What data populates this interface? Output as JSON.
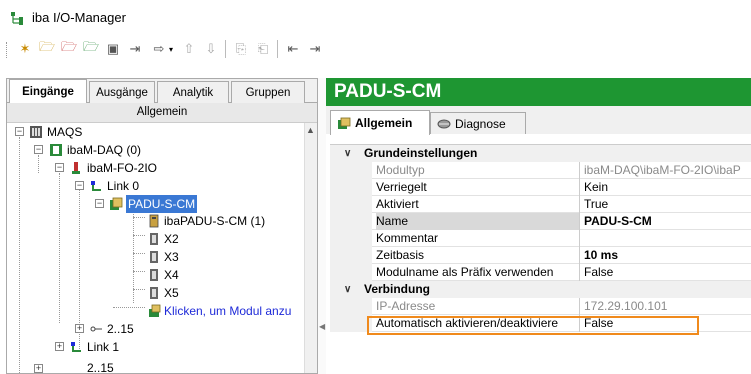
{
  "app": {
    "title": "iba I/O-Manager",
    "icon": "tree-network-icon"
  },
  "toolbar": {
    "buttons": [
      {
        "name": "new-icon",
        "glyph": "✶"
      },
      {
        "name": "open-icon",
        "glyph": "🗁"
      },
      {
        "name": "export-icon",
        "glyph": "🗁"
      },
      {
        "name": "import-icon",
        "glyph": "🗁"
      },
      {
        "name": "save-icon",
        "glyph": "▣"
      },
      {
        "name": "apply-icon",
        "glyph": "⇥"
      },
      {
        "name": "transfer-icon",
        "glyph": "⇨"
      },
      {
        "name": "move-up-icon",
        "glyph": "⇧"
      },
      {
        "name": "move-down-icon",
        "glyph": "⇩"
      },
      {
        "name": "copy-icon",
        "glyph": "⎘"
      },
      {
        "name": "paste-icon",
        "glyph": "⎗"
      },
      {
        "name": "collapse-icon",
        "glyph": "⇤"
      },
      {
        "name": "expand-icon",
        "glyph": "⇥"
      }
    ]
  },
  "left_tabs": [
    "Eingänge",
    "Ausgänge",
    "Analytik",
    "Gruppen"
  ],
  "left_subheader": "Allgemein",
  "tree": {
    "maqs": "MAQS",
    "ibam_daq": "ibaM-DAQ (0)",
    "ibam_fo": "ibaM-FO-2IO",
    "link0": "Link 0",
    "padu": "PADU-S-CM",
    "ibapadu": "ibaPADU-S-CM (1)",
    "x2": "X2",
    "x3": "X3",
    "x4": "X4",
    "x5": "X5",
    "add_module": "Klicken, um Modul anzu",
    "range": "2..15",
    "link1": "Link 1",
    "bottom": "2..15"
  },
  "right": {
    "header": "PADU-S-CM",
    "tabs": [
      "Allgemein",
      "Diagnose"
    ],
    "categories": {
      "grund": "Grundeinstellungen",
      "verbindung": "Verbindung"
    },
    "properties": [
      {
        "name": "Modultyp",
        "value": "ibaM-DAQ\\ibaM-FO-2IO\\ibaP"
      },
      {
        "name": "Verriegelt",
        "value": "Kein"
      },
      {
        "name": "Aktiviert",
        "value": "True"
      },
      {
        "name": "Name",
        "value": "PADU-S-CM"
      },
      {
        "name": "Kommentar",
        "value": ""
      },
      {
        "name": "Zeitbasis",
        "value": "10 ms"
      },
      {
        "name": "Modulname als Präfix verwenden",
        "value": "False"
      },
      {
        "name": "IP-Adresse",
        "value": "172.29.100.101"
      },
      {
        "name": "Automatisch aktivieren/deaktiviere",
        "value": "False"
      }
    ]
  },
  "colors": {
    "header_green": "#1e9632",
    "selection_blue": "#3a78d4",
    "highlight_orange": "#f08a1c",
    "link_blue": "#1e2ad8"
  }
}
